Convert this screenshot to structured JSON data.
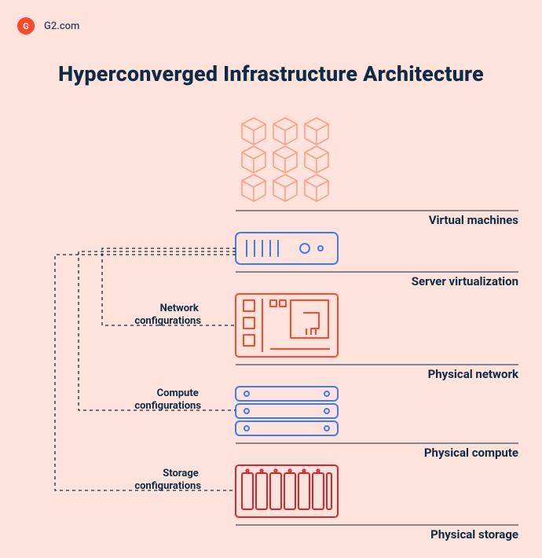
{
  "brand": {
    "label": "G2.com",
    "logo_text": "G"
  },
  "title": "Hyperconverged Infrastructure Architecture",
  "layers": {
    "vm": "Virtual machines",
    "server_virt": "Server virtualization",
    "phys_net": "Physical network",
    "phys_compute": "Physical compute",
    "phys_storage": "Physical storage"
  },
  "configs": {
    "network": "Network\nconfigurations",
    "compute": "Compute\nconfigurations",
    "storage": "Storage\nconfigurations"
  },
  "colors": {
    "bg": "#FDE3DC",
    "accent_red": "#FF492C",
    "accent_blue": "#3E7BFA",
    "salmon": "#F6A08B",
    "dark": "#0E2A47",
    "crimson": "#D9262C"
  }
}
